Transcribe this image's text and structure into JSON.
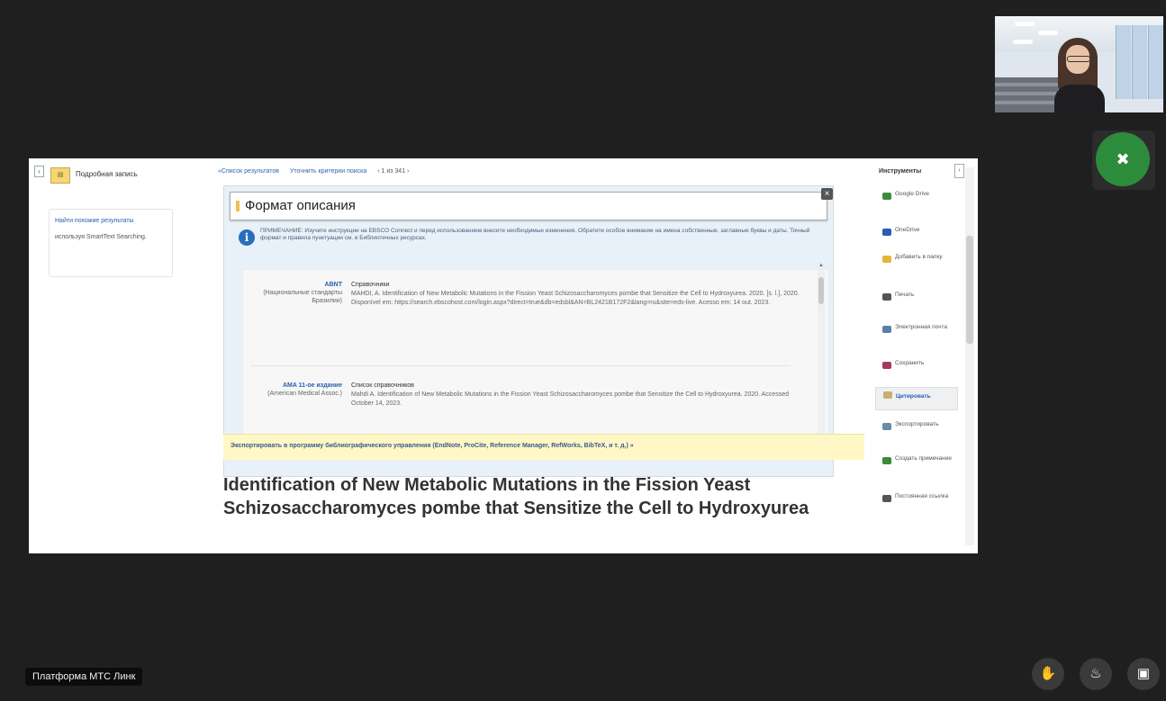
{
  "left_panel": {
    "detail_title": "Подробная запись",
    "smart_link": "Найти похожие результаты",
    "smart_text": "используя SmartText Searching."
  },
  "nav": {
    "results_link": "«Список результатов",
    "refine_link": "Уточнить критерии поиска",
    "count": "‹ 1 из 341 ›"
  },
  "modal": {
    "title": "Формат описания",
    "note": "ПРИМЕЧАНИЕ: Изучите инструкции на EBSCO Connect и перед использованием внесите необходимые изменения. Обратите особое внимание на имена собственные, заглавные буквы и даты. Точный формат и правила пунктуации см. в Библиотечных ресурсах.",
    "citations": [
      {
        "std": "ABNT",
        "desc": "(Национальные стандарты Бразилии)",
        "heading": "Справочники",
        "text": "MAHDI, A. Identification of New Metabolic Mutations in the Fission Yeast Schizosaccharomyces pombe that Sensitize the Cell to Hydroxyurea. 2020. [s. l.], 2020. Disponível em: https://search.ebscohost.com/login.aspx?direct=true&db=edsbl&AN=BL2421B172F2&lang=ru&site=eds-live. Acesso em: 14 out. 2023."
      },
      {
        "std": "AMA 11-ое издание",
        "desc": "(American Medical Assoc.)",
        "heading": "Список справочников",
        "text": "Mahdi A. Identification of New Metabolic Mutations in the Fission Yeast Schizosaccharomyces pombe that Sensitize the Cell to Hydroxyurea. 2020. Accessed October 14, 2023."
      }
    ],
    "export_text": "Экспортировать в программу библиографического управления (EndNote, ProCite, Reference Manager, RefWorks, BibTeX, и т. д.) »"
  },
  "article_title": "Identification of New Metabolic Mutations in the Fission Yeast Schizosaccharomyces pombe that Sensitize the Cell to Hydroxyurea",
  "tools": {
    "title": "Инструменты",
    "items": [
      {
        "label": "Google Drive",
        "icon": "google-drive-icon",
        "color": "#3b8d3b"
      },
      {
        "label": "OneDrive",
        "icon": "onedrive-icon",
        "color": "#2a5db0"
      },
      {
        "label": "Добавить в папку",
        "icon": "folder-icon",
        "color": "#e5b53a"
      },
      {
        "label": "Печать",
        "icon": "print-icon",
        "color": "#555555"
      },
      {
        "label": "Электронная почта",
        "icon": "email-icon",
        "color": "#5a7fa8"
      },
      {
        "label": "Сохранить",
        "icon": "save-icon",
        "color": "#a83a5a"
      },
      {
        "label": "Цитировать",
        "icon": "cite-icon",
        "color": "#c9b06a"
      },
      {
        "label": "Экспортировать",
        "icon": "export-icon",
        "color": "#6a8aa8"
      },
      {
        "label": "Создать примечание",
        "icon": "note-icon",
        "color": "#3a8a3a"
      },
      {
        "label": "Постоянная ссылка",
        "icon": "link-icon",
        "color": "#555555"
      }
    ]
  },
  "conference": {
    "platform_label": "Платформа МТС Линк",
    "accent": "#2c8c3c"
  }
}
